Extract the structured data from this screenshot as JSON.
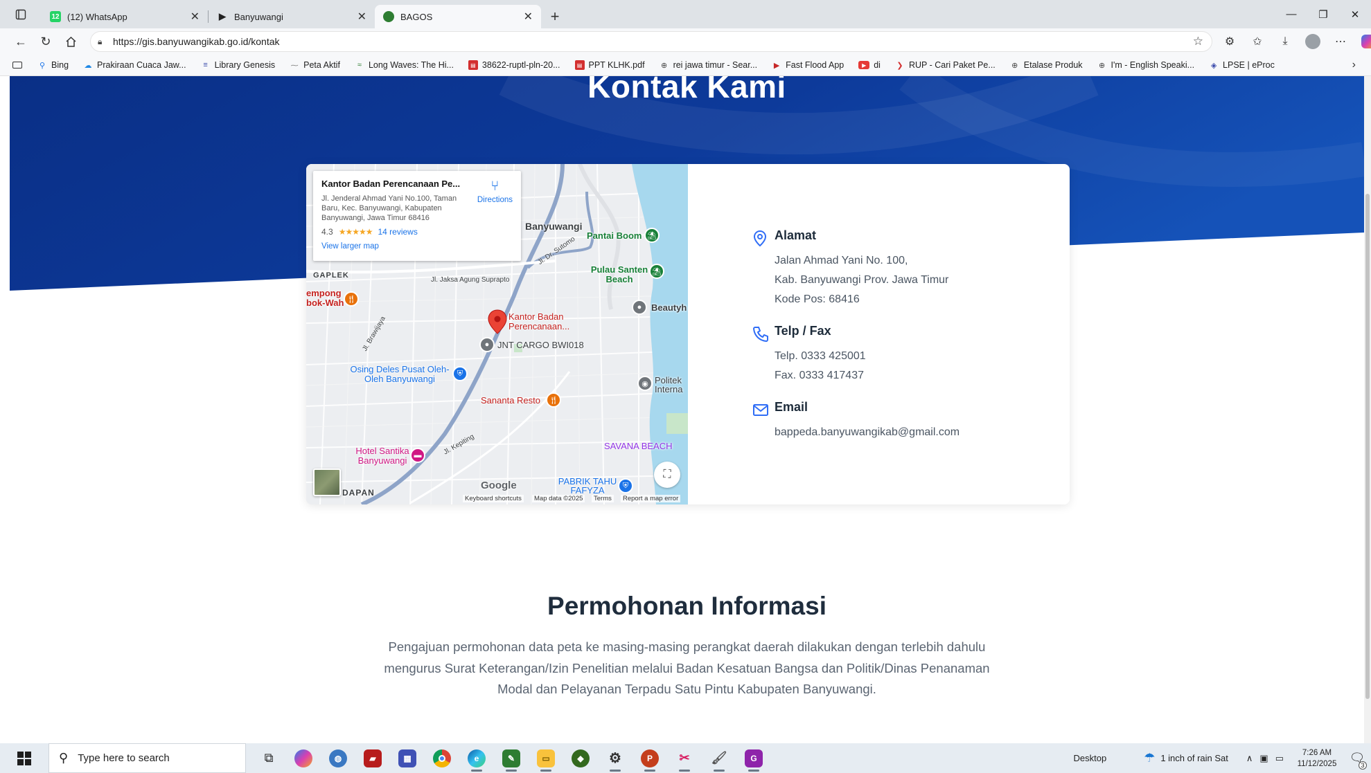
{
  "tabs": [
    {
      "title": "(12) WhatsApp",
      "icon": "whatsapp-icon",
      "badge": "12",
      "color": "#25d366"
    },
    {
      "title": "Banyuwangi",
      "icon": "play-icon",
      "color": "#222222"
    },
    {
      "title": "BAGOS",
      "icon": "bagos-logo-icon",
      "color": "#2e7d32",
      "active": true
    }
  ],
  "address": {
    "url": "https://gis.banyuwangikab.go.id/kontak"
  },
  "bookmarks": [
    {
      "label": "Bing",
      "icon": "search-icon"
    },
    {
      "label": "Prakiraan Cuaca Jaw...",
      "icon": "weather-icon"
    },
    {
      "label": "Library Genesis",
      "icon": "book-icon"
    },
    {
      "label": "Peta Aktif",
      "icon": "map-icon"
    },
    {
      "label": "Long Waves: The Hi...",
      "icon": "wave-icon"
    },
    {
      "label": "38622-ruptl-pln-20...",
      "icon": "pdf-icon"
    },
    {
      "label": "PPT KLHK.pdf",
      "icon": "pdf-icon"
    },
    {
      "label": "rei jawa timur - Sear...",
      "icon": "globe-icon"
    },
    {
      "label": "Fast Flood App",
      "icon": "app-icon"
    },
    {
      "label": "di",
      "icon": "youtube-icon"
    },
    {
      "label": "RUP - Cari Paket Pe...",
      "icon": "rup-icon"
    },
    {
      "label": "Etalase Produk",
      "icon": "globe-icon"
    },
    {
      "label": "I'm - English Speaki...",
      "icon": "globe-icon"
    },
    {
      "label": "LPSE | eProc",
      "icon": "lpse-icon"
    }
  ],
  "page": {
    "heading": "Kontak Kami",
    "colors": {
      "hero_dark": "#0a2f86",
      "hero_light": "#1552b8",
      "accent": "#2f6df6"
    },
    "map": {
      "place_name": "Kantor Badan Perencanaan Pe...",
      "place_address": "Jl. Jenderal Ahmad Yani No.100, Taman Baru, Kec. Banyuwangi, Kabupaten Banyuwangi, Jawa Timur 68416",
      "rating": "4.3",
      "stars": "★★★★★",
      "reviews": "14 reviews",
      "larger_map": "View larger map",
      "directions": "Directions",
      "marker_label": "Kantor Badan Perencanaan...",
      "labels": [
        {
          "text": "Banyuwangi",
          "color": "#3c4043"
        },
        {
          "text": "Pantai Boom",
          "color": "#188038"
        },
        {
          "text": "Pulau Santen Beach",
          "color": "#188038"
        },
        {
          "text": "GAPLEK",
          "color": "#3c4043"
        },
        {
          "text": "Jl. Jaksa Agung Suprapto",
          "color": "#3c4043"
        },
        {
          "text": "Jl. Dr. Sutomo",
          "color": "#3c4043"
        },
        {
          "text": "empong bok-Wah",
          "color": "#c5221f"
        },
        {
          "text": "Beautyh",
          "color": "#3c4043"
        },
        {
          "text": "JNT CARGO BWI018",
          "color": "#3c4043"
        },
        {
          "text": "Osing Deles Pusat Oleh-Oleh Banyuwangi",
          "color": "#1a73e8"
        },
        {
          "text": "Politek Interna",
          "color": "#3c4043"
        },
        {
          "text": "Sananta Resto",
          "color": "#c5221f"
        },
        {
          "text": "Hotel Santika Banyuwangi",
          "color": "#d01884"
        },
        {
          "text": "SAVANA BEACH",
          "color": "#9334e6"
        },
        {
          "text": "PABRIK TAHU FAFYZA",
          "color": "#1a73e8"
        },
        {
          "text": "DAPAN",
          "color": "#3c4043"
        },
        {
          "text": "Jl. Kepiting",
          "color": "#3c4043"
        },
        {
          "text": "Jl. Brawijaya",
          "color": "#3c4043"
        }
      ],
      "google": "Google",
      "footer": [
        "Keyboard shortcuts",
        "Map data ©2025",
        "Terms",
        "Report a map error"
      ]
    },
    "contact": {
      "alamat": {
        "title": "Alamat",
        "lines": [
          "Jalan Ahmad Yani No. 100,",
          "Kab. Banyuwangi Prov. Jawa Timur",
          "Kode Pos: 68416"
        ]
      },
      "telp": {
        "title": "Telp / Fax",
        "lines": [
          "Telp. 0333 425001",
          "Fax. 0333 417437"
        ]
      },
      "email": {
        "title": "Email",
        "lines": [
          "bappeda.banyuwangikab@gmail.com"
        ]
      }
    },
    "permohonan": {
      "title": "Permohonan Informasi",
      "text": "Pengajuan permohonan data peta ke masing-masing perangkat daerah dilakukan dengan terlebih dahulu mengurus Surat Keterangan/Izin Penelitian melalui Badan Kesatuan Bangsa dan Politik/Dinas Penanaman Modal dan Pelayanan Terpadu Satu Pintu Kabupaten Banyuwangi."
    }
  },
  "taskbar": {
    "search_placeholder": "Type here to search",
    "desktop": "Desktop",
    "weather": "1 inch of rain Sat",
    "time": "7:26 AM",
    "date": "11/12/2025",
    "notifications": "3"
  }
}
